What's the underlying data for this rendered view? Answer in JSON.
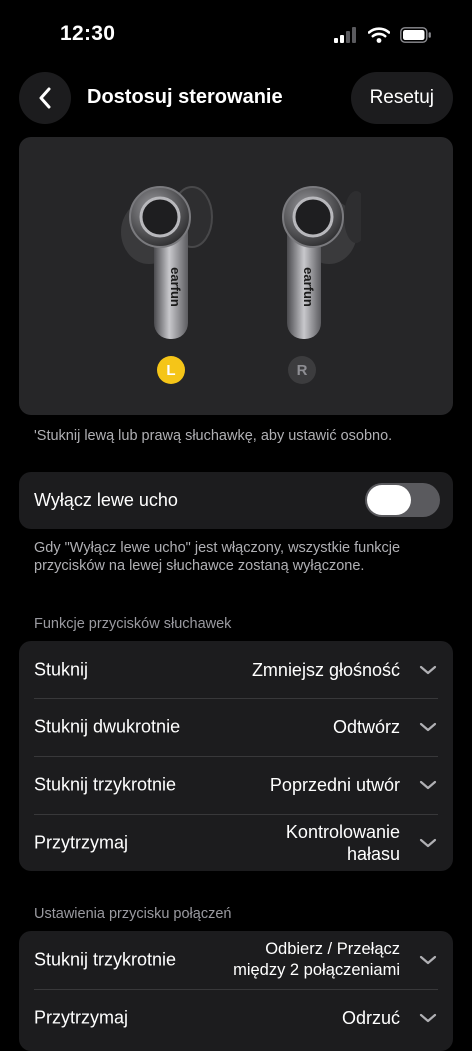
{
  "status_bar": {
    "time": "12:30"
  },
  "nav": {
    "title": "Dostosuj sterowanie",
    "reset": "Resetuj"
  },
  "earbuds": {
    "left_badge": "L",
    "right_badge": "R",
    "brand": "earfun"
  },
  "earbuds_hint": "'Stuknij lewą lub prawą słuchawkę, aby ustawić osobno.",
  "toggle": {
    "label": "Wyłącz lewe ucho",
    "on": false
  },
  "toggle_note": "Gdy \"Wyłącz lewe ucho\" jest włączony, wszystkie funkcje przycisków na lewej słuchawce zostaną wyłączone.",
  "sections": {
    "buttons": {
      "title": "Funkcje przycisków słuchawek",
      "rows": [
        {
          "label": "Stuknij",
          "value": "Zmniejsz głośność"
        },
        {
          "label": "Stuknij dwukrotnie",
          "value": "Odtwórz"
        },
        {
          "label": "Stuknij trzykrotnie",
          "value": "Poprzedni utwór"
        },
        {
          "label": "Przytrzymaj",
          "value": "Kontrolowanie hałasu"
        }
      ]
    },
    "calls": {
      "title": "Ustawienia przycisku połączeń",
      "rows": [
        {
          "label": "Stuknij trzykrotnie",
          "value": "Odbierz / Przełącz między 2 połączeniami"
        },
        {
          "label": "Przytrzymaj",
          "value": "Odrzuć"
        }
      ]
    }
  },
  "colors": {
    "accent": "#f5c518",
    "card": "#1c1c1e",
    "background": "#000000"
  }
}
